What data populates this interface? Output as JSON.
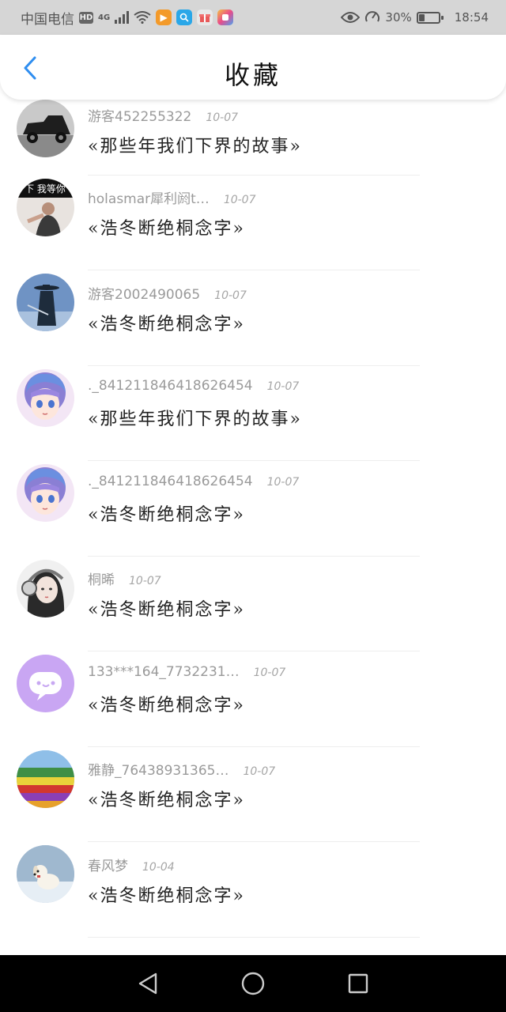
{
  "status_bar": {
    "carrier": "中国电信",
    "hd_badge": "HD",
    "network": "4G",
    "battery_percent": "30%",
    "battery_level": 0.3,
    "time": "18:54"
  },
  "header": {
    "title": "收藏"
  },
  "items": [
    {
      "username": "游客452255322",
      "date": "10-07",
      "title": "«那些年我们下界的故事»",
      "avatar": "vintage-car-avatar",
      "avatar_text": ""
    },
    {
      "username": "holasmar犀利阏t…",
      "date": "10-07",
      "title": "«浩冬断绝桐念字»",
      "avatar": "person-text-avatar",
      "avatar_text": "下 我等你"
    },
    {
      "username": "游客2002490065",
      "date": "10-07",
      "title": "«浩冬断绝桐念字»",
      "avatar": "swordsman-avatar",
      "avatar_text": ""
    },
    {
      "username": "._841211846418626454",
      "date": "10-07",
      "title": "«那些年我们下界的故事»",
      "avatar": "anime-girl-avatar",
      "avatar_text": ""
    },
    {
      "username": "._841211846418626454",
      "date": "10-07",
      "title": "«浩冬断绝桐念字»",
      "avatar": "anime-girl-avatar",
      "avatar_text": ""
    },
    {
      "username": "桐晞",
      "date": "10-07",
      "title": "«浩冬断绝桐念字»",
      "avatar": "girl-headphones-avatar",
      "avatar_text": ""
    },
    {
      "username": "133***164_7732231…",
      "date": "10-07",
      "title": "«浩冬断绝桐念字»",
      "avatar": "chat-bubble-avatar",
      "avatar_text": ""
    },
    {
      "username": "雅静_76438931365…",
      "date": "10-07",
      "title": "«浩冬断绝桐念字»",
      "avatar": "flower-field-avatar",
      "avatar_text": ""
    },
    {
      "username": "春风梦",
      "date": "10-04",
      "title": "«浩冬断绝桐念字»",
      "avatar": "dog-snow-avatar",
      "avatar_text": ""
    }
  ],
  "nav": {
    "back": "back-icon",
    "home": "home-icon",
    "recents": "recents-icon"
  },
  "colors": {
    "accent": "#2f8ef0",
    "status_bar_bg": "#d6d6d6",
    "nav_bg": "#000000"
  }
}
